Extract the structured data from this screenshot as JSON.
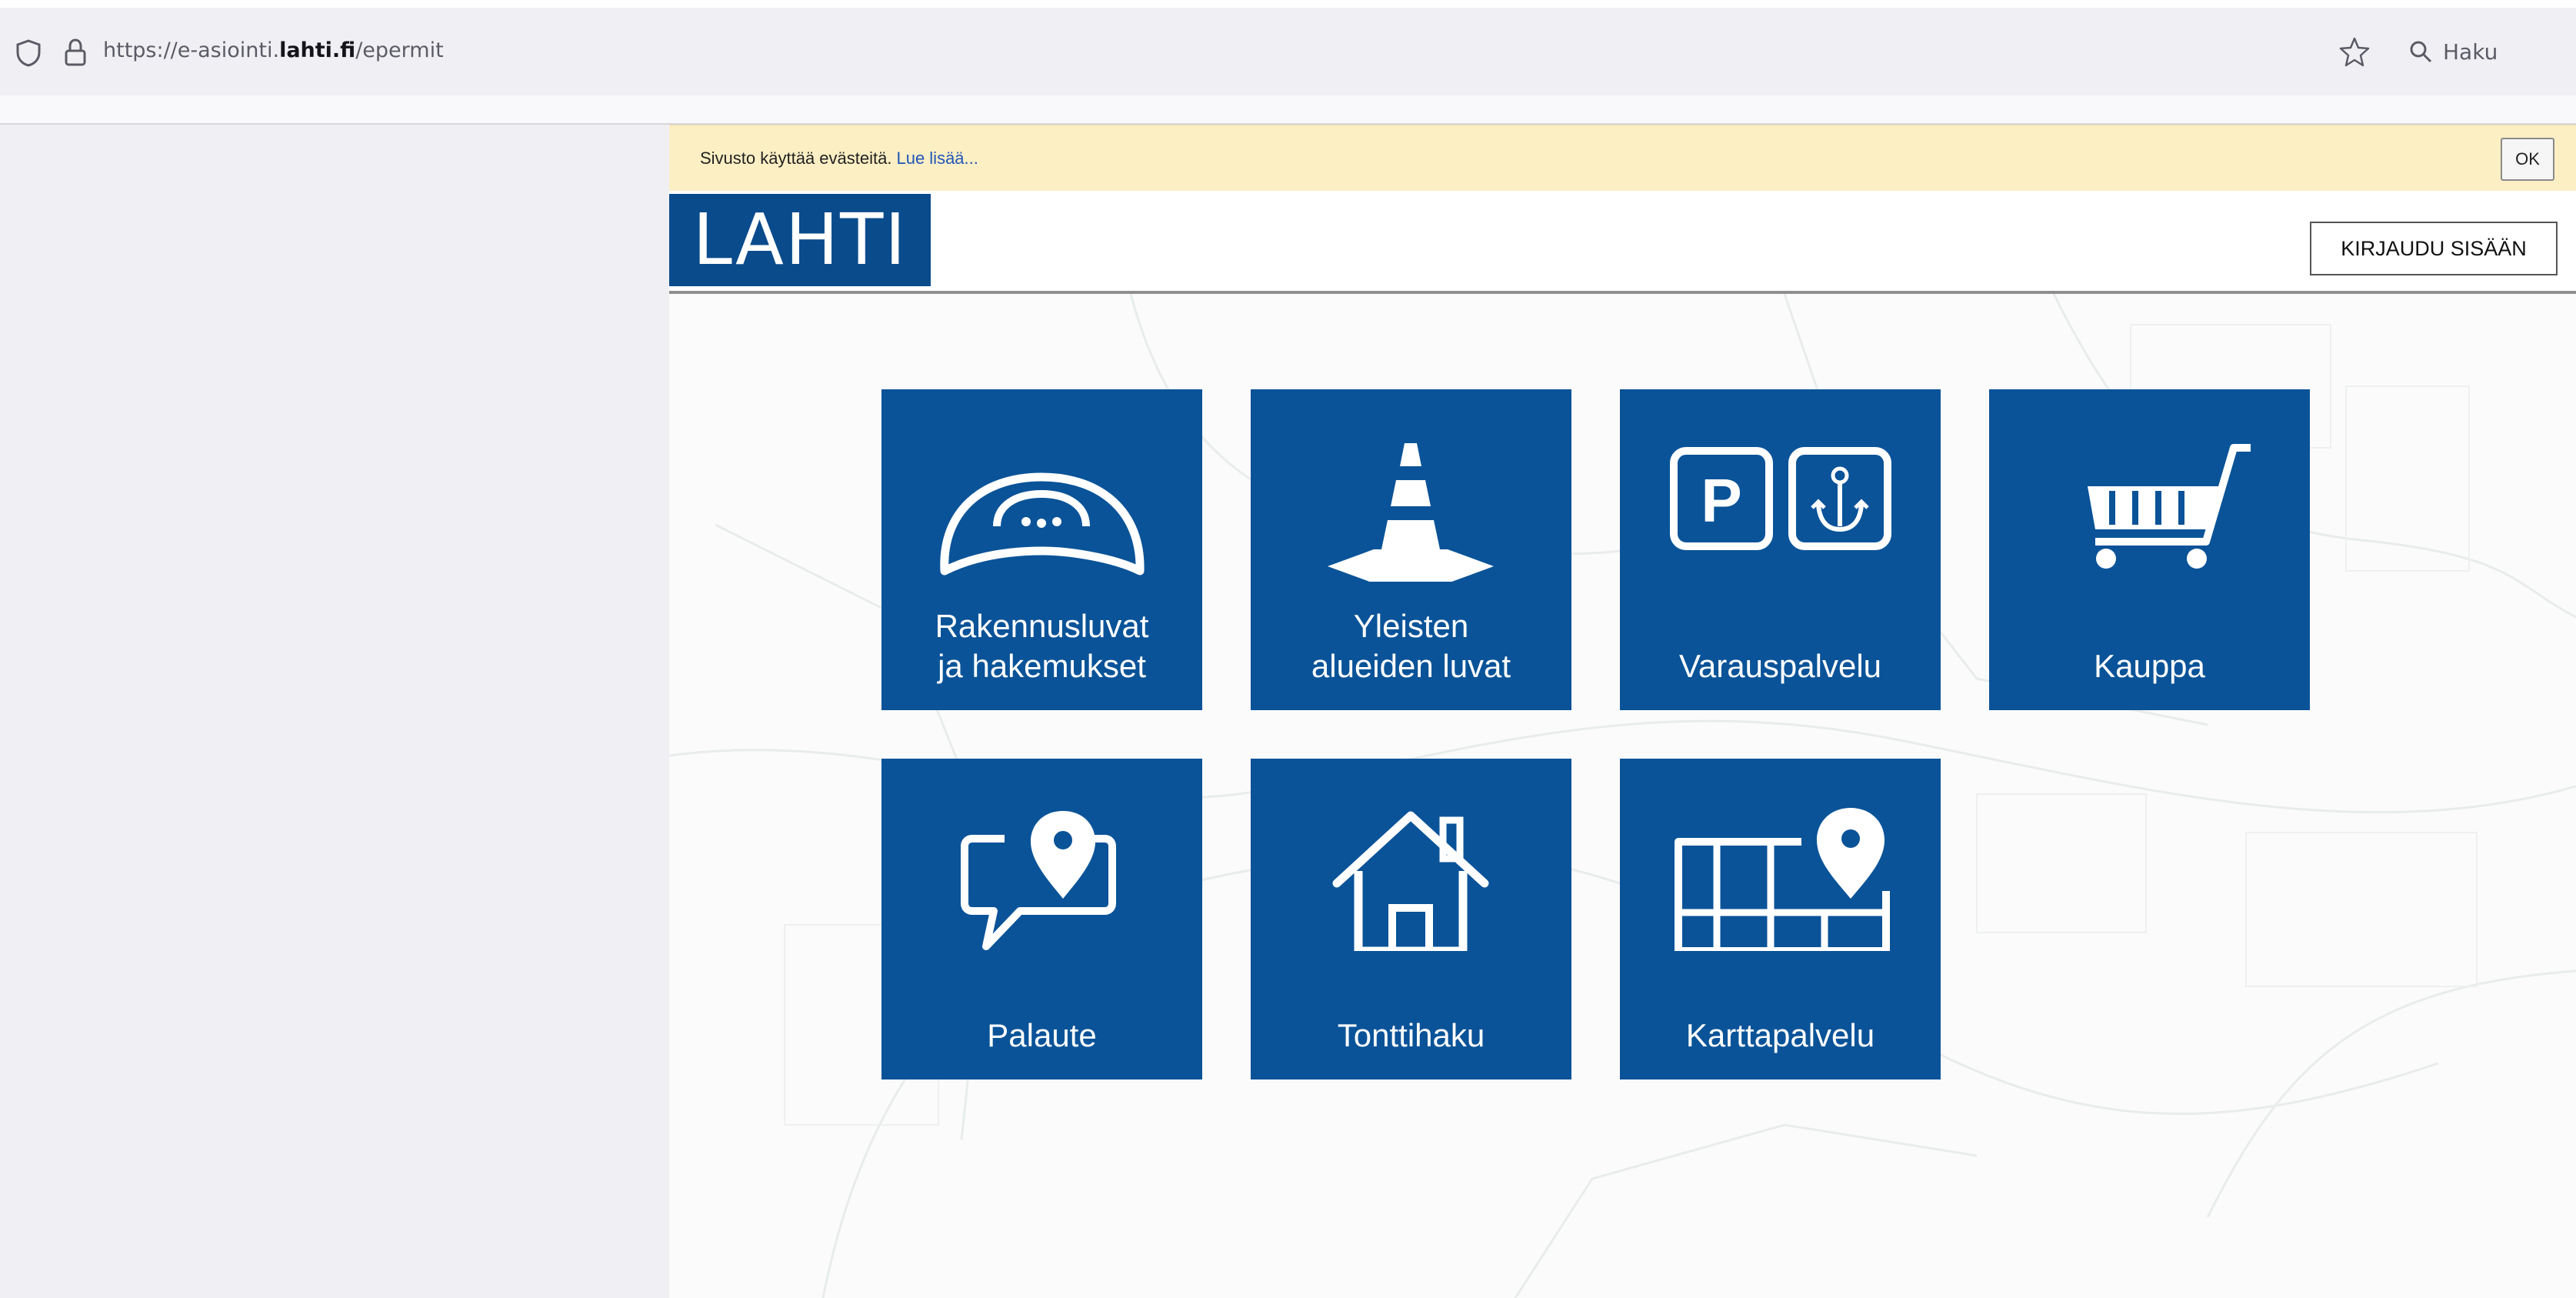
{
  "browser": {
    "url_prefix": "https://e-asiointi.",
    "url_domain": "lahti.fi",
    "url_path": "/epermit",
    "search_placeholder": "Haku"
  },
  "cookie_bar": {
    "text": "Sivusto käyttää evästeitä.",
    "link": "Lue lisää...",
    "ok_label": "OK"
  },
  "header": {
    "logo_text": "LAHTI",
    "login_label": "KIRJAUDU SISÄÄN"
  },
  "tiles": [
    {
      "label_line1": "Rakennusluvat",
      "label_line2": "ja hakemukset",
      "icon": "hard-hat-icon"
    },
    {
      "label_line1": "Yleisten",
      "label_line2": "alueiden luvat",
      "icon": "traffic-cone-icon"
    },
    {
      "label_line1": "Varauspalvelu",
      "label_line2": "",
      "icon": "parking-anchor-icon"
    },
    {
      "label_line1": "Kauppa",
      "label_line2": "",
      "icon": "shopping-cart-icon"
    },
    {
      "label_line1": "Palaute",
      "label_line2": "",
      "icon": "feedback-pin-icon"
    },
    {
      "label_line1": "Tonttihaku",
      "label_line2": "",
      "icon": "house-icon"
    },
    {
      "label_line1": "Karttapalvelu",
      "label_line2": "",
      "icon": "map-pin-icon"
    }
  ],
  "colors": {
    "tile_blue": "#0a5398",
    "logo_blue": "#0a4b8c",
    "cookie_bg": "#fcefc4"
  }
}
